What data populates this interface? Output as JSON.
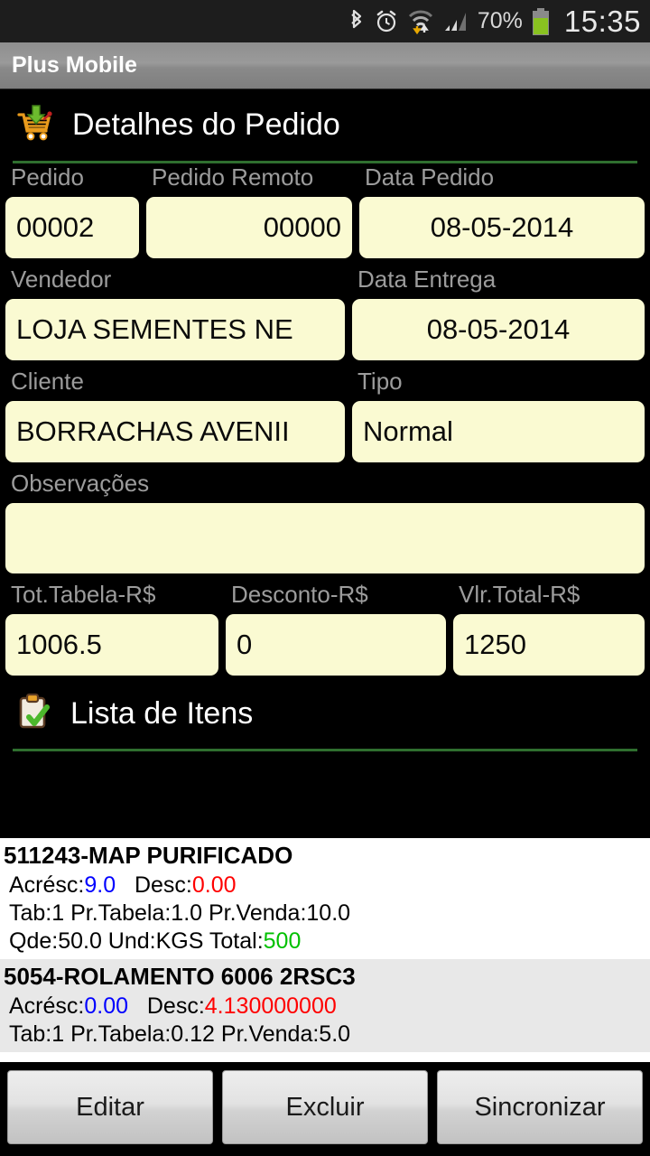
{
  "statusbar": {
    "icons": [
      "bluetooth-icon",
      "alarm-icon",
      "wifi-icon",
      "signal-icon"
    ],
    "battery_percent": "70%",
    "clock": "15:35"
  },
  "titlebar": {
    "app_name": "Plus Mobile"
  },
  "header": {
    "title": "Detalhes do Pedido",
    "icon": "shopping-cart-download-icon"
  },
  "form": {
    "row1": [
      {
        "label": "Pedido",
        "value": "00002",
        "align": "a-left"
      },
      {
        "label": "Pedido Remoto",
        "value": "00000",
        "align": "a-right"
      },
      {
        "label": "Data Pedido",
        "value": "08-05-2014",
        "align": "a-center"
      }
    ],
    "row2": [
      {
        "label": "Vendedor",
        "value": "LOJA SEMENTES NE",
        "align": "a-left"
      },
      {
        "label": "Data Entrega",
        "value": "08-05-2014",
        "align": "a-center"
      }
    ],
    "row3": [
      {
        "label": "Cliente",
        "value": "BORRACHAS AVENII",
        "align": "a-left"
      },
      {
        "label": "Tipo",
        "value": "Normal",
        "align": "a-left"
      }
    ],
    "row4": [
      {
        "label": "Observações",
        "value": "",
        "align": "a-left"
      }
    ],
    "row5": [
      {
        "label": "Tot.Tabela-R$",
        "value": "1006.5",
        "align": "a-left"
      },
      {
        "label": "Desconto-R$",
        "value": "0",
        "align": "a-left"
      },
      {
        "label": "Vlr.Total-R$",
        "value": "1250",
        "align": "a-left"
      }
    ]
  },
  "items_header": {
    "title": "Lista de Itens",
    "icon": "clipboard-check-icon"
  },
  "items": [
    {
      "name": "511243-MAP PURIFICADO",
      "acresc_label": "Acrésc:",
      "acresc": "9.0",
      "desc_label": "Desc:",
      "desc": "0.00",
      "line2": "Tab:1  Pr.Tabela:1.0  Pr.Venda:10.0",
      "qde_label": "Qde:50.0   Und:KGS   Total:",
      "total": "500"
    },
    {
      "name": "5054-ROLAMENTO 6006 2RSC3",
      "acresc_label": "Acrésc:",
      "acresc": "0.00",
      "desc_label": "Desc:",
      "desc": "4.130000000",
      "line2": "Tab:1  Pr.Tabela:0.12  Pr.Venda:5.0",
      "qde_label": "",
      "total": ""
    }
  ],
  "buttons": [
    {
      "label": "Editar"
    },
    {
      "label": "Excluir"
    },
    {
      "label": "Sincronizar"
    }
  ],
  "colors": {
    "field_bg": "#fafad2",
    "accent_green": "#2f6f2f",
    "value_blue": "#0000ff",
    "value_red": "#ff0000",
    "value_green": "#00c000"
  }
}
